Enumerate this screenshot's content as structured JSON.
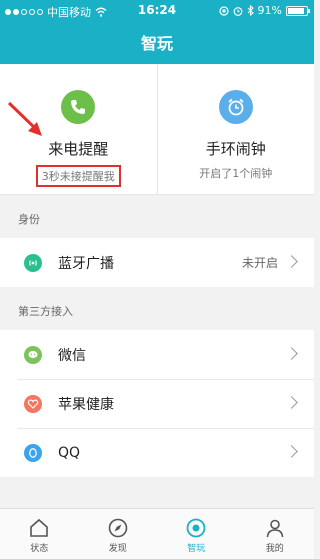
{
  "status_bar": {
    "carrier": "中国移动",
    "time": "16:24",
    "battery_text": "91%",
    "battery_level": 0.91
  },
  "header": {
    "title": "智玩"
  },
  "cards": [
    {
      "title": "来电提醒",
      "subtitle": "3秒未接提醒我",
      "icon": "phone-icon",
      "color": "#6cc04a"
    },
    {
      "title": "手环闹钟",
      "subtitle": "开启了1个闹钟",
      "icon": "alarm-clock-icon",
      "color": "#5aaeea"
    }
  ],
  "sections": {
    "identity": {
      "label": "身份",
      "items": [
        {
          "label": "蓝牙广播",
          "value": "未开启",
          "icon": "bluetooth-broadcast-icon",
          "color": "#2bbf8f"
        }
      ]
    },
    "third_party": {
      "label": "第三方接入",
      "items": [
        {
          "label": "微信",
          "icon": "wechat-icon",
          "color": "#7cc35a"
        },
        {
          "label": "苹果健康",
          "icon": "heart-icon",
          "color": "#f47560"
        },
        {
          "label": "QQ",
          "icon": "qq-icon",
          "color": "#3aa3ee"
        }
      ]
    }
  },
  "tabbar": {
    "items": [
      {
        "label": "状态",
        "icon": "home-icon"
      },
      {
        "label": "发现",
        "icon": "compass-icon"
      },
      {
        "label": "智玩",
        "icon": "smart-play-icon",
        "active": true
      },
      {
        "label": "我的",
        "icon": "person-icon"
      }
    ]
  },
  "colors": {
    "accent": "#1ab0c5",
    "annotation": "#e0312e"
  }
}
